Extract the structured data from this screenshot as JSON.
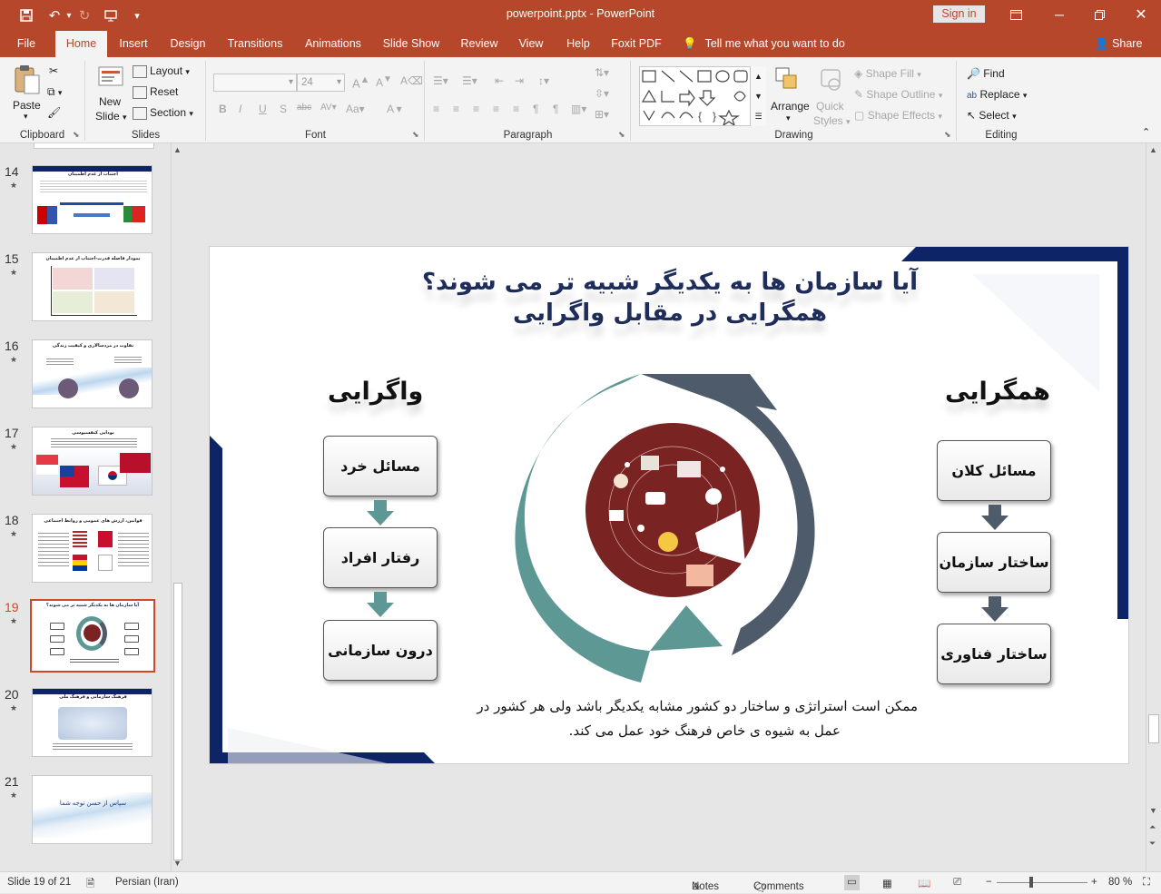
{
  "window": {
    "title": "powerpoint.pptx  -  PowerPoint",
    "signin": "Sign in"
  },
  "tabs": [
    "File",
    "Home",
    "Insert",
    "Design",
    "Transitions",
    "Animations",
    "Slide Show",
    "Review",
    "View",
    "Help",
    "Foxit PDF"
  ],
  "tellme": "Tell me what you want to do",
  "share": "Share",
  "ribbon": {
    "clipboard": {
      "label": "Clipboard",
      "paste": "Paste"
    },
    "slides": {
      "label": "Slides",
      "new_slide": "New",
      "new_slide2": "Slide",
      "layout": "Layout",
      "reset": "Reset",
      "section": "Section"
    },
    "font": {
      "label": "Font",
      "size": "24"
    },
    "paragraph": {
      "label": "Paragraph"
    },
    "drawing": {
      "label": "Drawing",
      "arrange": "Arrange",
      "quick_styles": "Quick",
      "quick_styles2": "Styles",
      "shape_fill": "Shape Fill",
      "shape_outline": "Shape Outline",
      "shape_effects": "Shape Effects"
    },
    "editing": {
      "label": "Editing",
      "find": "Find",
      "replace": "Replace",
      "select": "Select"
    }
  },
  "thumbnails": [
    {
      "num": "14",
      "title": "اجتناب از عدم اطمینان"
    },
    {
      "num": "15",
      "title": "نمودار فاصله قدرت-اجتناب از عدم اطمینان"
    },
    {
      "num": "16",
      "title": "تفاوت در مردسالاری و کیفیت زندگی"
    },
    {
      "num": "17",
      "title": "بودایی کنفسیوسی"
    },
    {
      "num": "18",
      "title": "قوانین، ارزش های عمومی و روابط اجتماعی"
    },
    {
      "num": "19",
      "title": "آیا سازمان ها به یکدیگر شبیه تر می شوند؟"
    },
    {
      "num": "20",
      "title": "فرهنگ سازمانی و فرهنگ ملی"
    },
    {
      "num": "21",
      "title": "سپاس از حسن توجه شما"
    }
  ],
  "slide": {
    "title_line1": "آیا سازمان ها به یکدیگر شبیه تر می شوند؟",
    "title_line2": "همگرایی در مقابل واگرایی",
    "left_heading": "واگرایی",
    "right_heading": "همگرایی",
    "left_boxes": [
      "مسائل خرد",
      "رفتار افراد",
      "درون سازمانی"
    ],
    "right_boxes": [
      "مسائل کلان",
      "ساختار سازمان",
      "ساختار فناوری"
    ],
    "caption_line1": "ممکن است استراتژی و ساختار دو کشور مشابه یکدیگر باشد ولی هر کشور در",
    "caption_line2": "عمل به شیوه ی  خاص فرهنگ خود عمل می کند.",
    "colors": {
      "navy": "#0d2466",
      "teal": "#5e9894",
      "slate": "#4d5b6b",
      "maroon": "#7a2323",
      "title": "#1f2d5a"
    }
  },
  "status": {
    "slide": "Slide 19 of 21",
    "language": "Persian (Iran)",
    "notes": "Notes",
    "comments": "Comments",
    "zoom": "80 %"
  }
}
